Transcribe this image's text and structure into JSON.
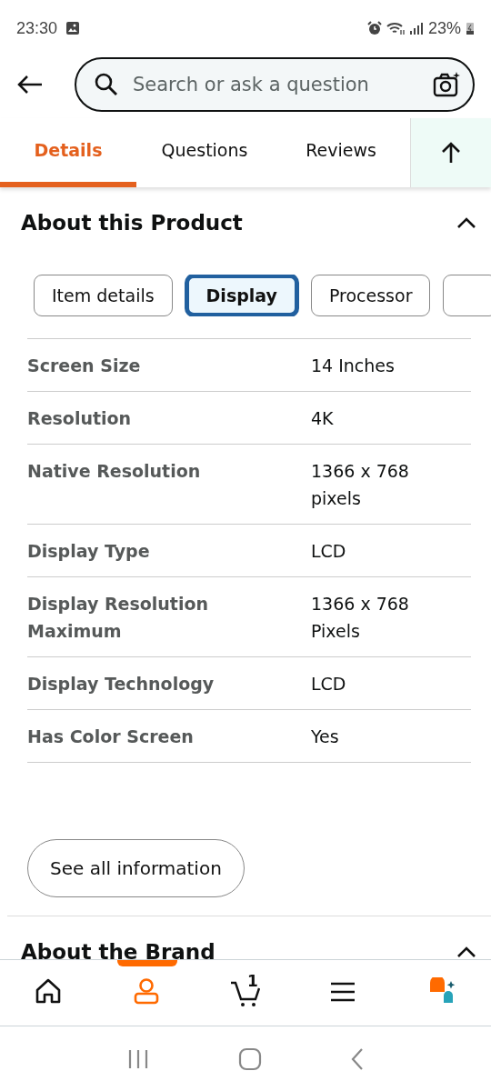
{
  "status_bar": {
    "time": "23:30",
    "battery": "23%"
  },
  "search": {
    "placeholder": "Search or ask a question"
  },
  "tabs": [
    {
      "label": "Details",
      "selected": true
    },
    {
      "label": "Questions",
      "selected": false
    },
    {
      "label": "Reviews",
      "selected": false
    }
  ],
  "sections": [
    {
      "title": "About this Product",
      "expanded": true,
      "chips": [
        {
          "kind": "chip",
          "label": "Item details",
          "selected": false
        },
        {
          "kind": "chip",
          "label": "Display",
          "selected": true
        },
        {
          "kind": "chip",
          "label": "Processor",
          "selected": false
        },
        {
          "kind": "cut",
          "selected": false
        }
      ],
      "rows": [
        {
          "name": "Screen Size",
          "value": "14 Inches"
        },
        {
          "name": "Resolution",
          "value": "4K"
        },
        {
          "name": "Native Resolution",
          "value": "1366 x 768 pixels"
        },
        {
          "name": "Display Type",
          "value": "LCD"
        },
        {
          "name": "Display Resolution Maximum",
          "value": "1366 x 768 Pixels"
        },
        {
          "name": "Display Technology",
          "value": "LCD"
        },
        {
          "name": "Has Color Screen",
          "value": "Yes"
        }
      ],
      "button": "See all information"
    },
    {
      "title": "About the Brand",
      "expanded": true
    }
  ],
  "bottom_nav": [
    {
      "kind": "home",
      "selected": false
    },
    {
      "kind": "account",
      "selected": true
    },
    {
      "kind": "cart",
      "badge": "1",
      "selected": false
    },
    {
      "kind": "menu",
      "selected": false
    },
    {
      "kind": "assistant",
      "selected": false
    }
  ]
}
